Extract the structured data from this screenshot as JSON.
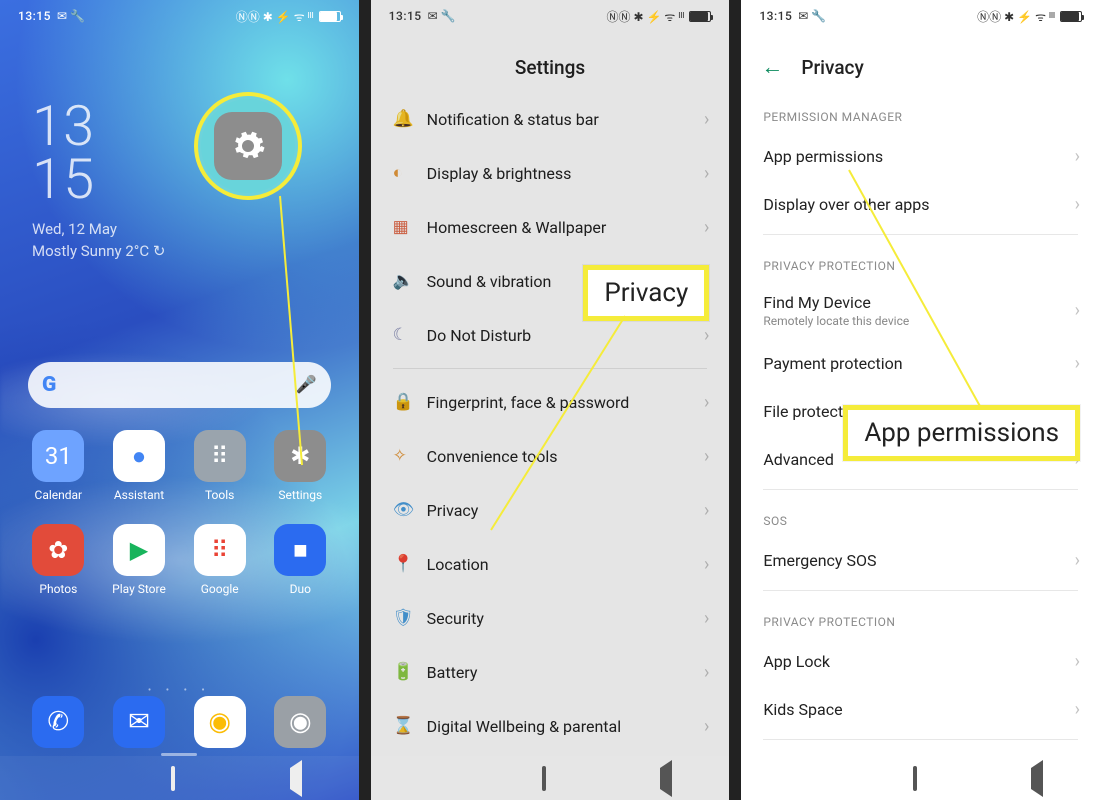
{
  "status": {
    "time": "13:15",
    "icons_left": "✉ 🔧",
    "icons_right": "ⓃⓃ ✱ ⚡ ᯤ ᴵᴵᴵ"
  },
  "home": {
    "clock_h": "13",
    "clock_m": "15",
    "date": "Wed, 12 May",
    "weather": "Mostly Sunny 2°C  ↻",
    "apps_row1": [
      {
        "name": "Calendar",
        "bg": "#6ea3ff",
        "glyph": "31"
      },
      {
        "name": "Assistant",
        "bg": "#ffffff",
        "glyph": "●",
        "fg": "#4285f4"
      },
      {
        "name": "Tools",
        "bg": "#9aa4ad",
        "glyph": "⠿"
      },
      {
        "name": "Settings",
        "bg": "#8d8d8d",
        "glyph": "✱"
      }
    ],
    "apps_row2": [
      {
        "name": "Photos",
        "bg": "#e24b3a",
        "glyph": "✿"
      },
      {
        "name": "Play Store",
        "bg": "#ffffff",
        "glyph": "▶",
        "fg": "#18b45c"
      },
      {
        "name": "Google",
        "bg": "#ffffff",
        "glyph": "⠿",
        "fg": "#ea4335"
      },
      {
        "name": "Duo",
        "bg": "#2b6bf0",
        "glyph": "■"
      }
    ],
    "dock": [
      {
        "name": "Phone",
        "bg": "#2b6bf0",
        "glyph": "✆"
      },
      {
        "name": "Messages",
        "bg": "#2b6bf0",
        "glyph": "✉"
      },
      {
        "name": "Chrome",
        "bg": "#ffffff",
        "glyph": "◉",
        "fg": "#fbbc05"
      },
      {
        "name": "Camera",
        "bg": "#9aa0a6",
        "glyph": "◉"
      }
    ]
  },
  "settings": {
    "title": "Settings",
    "items": [
      {
        "icon": "🔔",
        "label": "Notification & status bar",
        "color": "#e26a4a"
      },
      {
        "icon": "◐",
        "label": "Display & brightness",
        "color": "#e79a3c"
      },
      {
        "icon": "▦",
        "label": "Homescreen & Wallpaper",
        "color": "#e26a4a"
      },
      {
        "icon": "🔈",
        "label": "Sound & vibration",
        "color": "#3aa88a"
      },
      {
        "icon": "☾",
        "label": "Do Not Disturb",
        "color": "#8a8fb8"
      },
      {
        "icon": "🔒",
        "label": "Fingerprint, face & password",
        "color": "#4a9fe0"
      },
      {
        "icon": "✧",
        "label": "Convenience tools",
        "color": "#e79a3c"
      },
      {
        "icon": "👁",
        "label": "Privacy",
        "color": "#4a9fe0"
      },
      {
        "icon": "📍",
        "label": "Location",
        "color": "#e79a3c"
      },
      {
        "icon": "🛡",
        "label": "Security",
        "color": "#4a9fe0"
      },
      {
        "icon": "🔋",
        "label": "Battery",
        "color": "#3aa88a"
      },
      {
        "icon": "⌛",
        "label": "Digital Wellbeing & parental",
        "color": "#e79a3c"
      }
    ],
    "divider_after": 4
  },
  "privacy": {
    "title": "Privacy",
    "sections": [
      {
        "head": "PERMISSION MANAGER",
        "rows": [
          {
            "label": "App permissions"
          },
          {
            "label": "Display over other apps"
          }
        ]
      },
      {
        "head": "PRIVACY PROTECTION",
        "rows": [
          {
            "label": "Find My Device",
            "sub": "Remotely locate this device"
          },
          {
            "label": "Payment protection"
          },
          {
            "label": "File protection"
          },
          {
            "label": "Advanced"
          }
        ]
      },
      {
        "head": "SOS",
        "rows": [
          {
            "label": "Emergency SOS"
          }
        ]
      },
      {
        "head": "PRIVACY PROTECTION",
        "rows": [
          {
            "label": "App Lock"
          },
          {
            "label": "Kids Space"
          }
        ]
      }
    ]
  },
  "callouts": {
    "privacy": "Privacy",
    "app_perm": "App permissions"
  }
}
